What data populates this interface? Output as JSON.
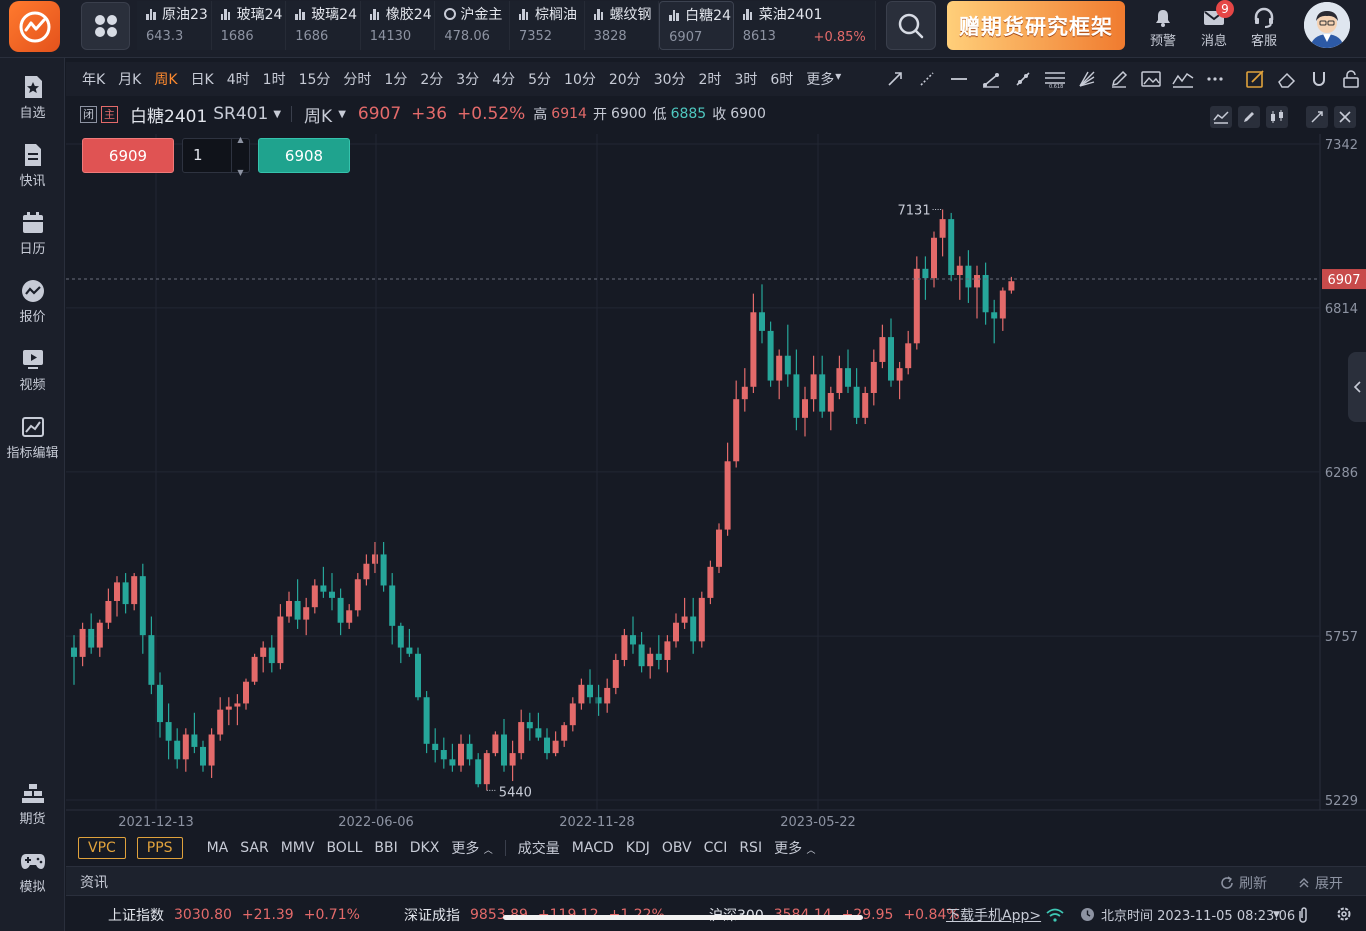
{
  "top": {
    "tickers": [
      {
        "name": "原油23",
        "price": "643.3",
        "change": ""
      },
      {
        "name": "玻璃24",
        "price": "1686",
        "change": ""
      },
      {
        "name": "玻璃24",
        "price": "1686",
        "change": ""
      },
      {
        "name": "橡胶24",
        "price": "14130",
        "change": ""
      },
      {
        "name": "沪金主",
        "price": "478.06",
        "change": ""
      },
      {
        "name": "棕榈油",
        "price": "7352",
        "change": ""
      },
      {
        "name": "螺纹钢",
        "price": "3828",
        "change": ""
      },
      {
        "name": "白糖24",
        "price": "6907",
        "change": ""
      },
      {
        "name": "菜油2401",
        "price": "8613",
        "change": "+0.85%"
      }
    ],
    "promo": "赠期货研究框架",
    "alert_label": "预警",
    "msg_label": "消息",
    "msg_badge": "9",
    "service_label": "客服"
  },
  "sidebar": {
    "items": [
      {
        "label": "自选",
        "icon": "star-doc-icon"
      },
      {
        "label": "快讯",
        "icon": "news-icon"
      },
      {
        "label": "日历",
        "icon": "calendar-icon"
      },
      {
        "label": "报价",
        "icon": "quote-icon"
      },
      {
        "label": "视频",
        "icon": "video-icon"
      },
      {
        "label": "指标编辑",
        "icon": "chart-edit-icon"
      },
      {
        "label": "期货",
        "icon": "futures-icon"
      },
      {
        "label": "模拟",
        "icon": "gamepad-icon"
      }
    ]
  },
  "toolbar": {
    "periods": [
      "年K",
      "月K",
      "周K",
      "日K",
      "4时",
      "1时",
      "15分",
      "分时",
      "1分",
      "2分",
      "3分",
      "4分",
      "5分",
      "10分",
      "20分",
      "30分",
      "2时",
      "3时",
      "6时",
      "更多"
    ],
    "selected": "周K"
  },
  "chart_header": {
    "tag1": "闭",
    "tag2": "主",
    "name": "白糖2401",
    "code": "SR401",
    "period": "周K",
    "last": "6907",
    "change": "+36",
    "pct": "+0.52%",
    "high_label": "高",
    "high": "6914",
    "open_label": "开",
    "open": "6900",
    "low_label": "低",
    "low": "6885",
    "close_label": "收",
    "close": "6900"
  },
  "trade": {
    "buy_price": "6909",
    "qty": "1",
    "sell_price": "6908"
  },
  "chart_data": {
    "type": "candlestick",
    "y_ticks": [
      "7342",
      "6814",
      "6286",
      "5757",
      "5229"
    ],
    "ylim": [
      5229,
      7342
    ],
    "x_ticks": [
      "2021-12-13",
      "2022-06-06",
      "2022-11-28",
      "2023-05-22"
    ],
    "current_price_label": "6907",
    "high_marker": "7131",
    "low_marker": "5440",
    "up_color": "#e36a6a",
    "down_color": "#26a69a",
    "ohlc": [
      [
        5720,
        5760,
        5600,
        5690
      ],
      [
        5690,
        5800,
        5660,
        5780
      ],
      [
        5780,
        5830,
        5700,
        5720
      ],
      [
        5720,
        5810,
        5690,
        5800
      ],
      [
        5800,
        5910,
        5780,
        5870
      ],
      [
        5870,
        5950,
        5820,
        5930
      ],
      [
        5930,
        5960,
        5830,
        5860
      ],
      [
        5860,
        5960,
        5840,
        5950
      ],
      [
        5950,
        5990,
        5700,
        5760
      ],
      [
        5760,
        5820,
        5570,
        5600
      ],
      [
        5600,
        5640,
        5430,
        5480
      ],
      [
        5480,
        5540,
        5360,
        5420
      ],
      [
        5420,
        5460,
        5330,
        5360
      ],
      [
        5360,
        5460,
        5320,
        5440
      ],
      [
        5440,
        5510,
        5380,
        5400
      ],
      [
        5400,
        5420,
        5320,
        5340
      ],
      [
        5340,
        5460,
        5300,
        5440
      ],
      [
        5440,
        5560,
        5420,
        5520
      ],
      [
        5520,
        5560,
        5470,
        5530
      ],
      [
        5530,
        5570,
        5470,
        5540
      ],
      [
        5540,
        5620,
        5520,
        5610
      ],
      [
        5610,
        5700,
        5600,
        5690
      ],
      [
        5690,
        5740,
        5640,
        5720
      ],
      [
        5720,
        5760,
        5640,
        5670
      ],
      [
        5670,
        5860,
        5650,
        5820
      ],
      [
        5820,
        5900,
        5800,
        5870
      ],
      [
        5870,
        5940,
        5780,
        5810
      ],
      [
        5810,
        5880,
        5760,
        5850
      ],
      [
        5850,
        5940,
        5830,
        5920
      ],
      [
        5920,
        5980,
        5880,
        5900
      ],
      [
        5900,
        5960,
        5840,
        5880
      ],
      [
        5880,
        5910,
        5760,
        5800
      ],
      [
        5800,
        5860,
        5780,
        5840
      ],
      [
        5840,
        5960,
        5820,
        5940
      ],
      [
        5940,
        6020,
        5920,
        5990
      ],
      [
        5990,
        6060,
        5960,
        6020
      ],
      [
        6020,
        6060,
        5900,
        5920
      ],
      [
        5920,
        5960,
        5730,
        5790
      ],
      [
        5790,
        5800,
        5670,
        5720
      ],
      [
        5720,
        5780,
        5690,
        5700
      ],
      [
        5700,
        5720,
        5550,
        5560
      ],
      [
        5560,
        5580,
        5380,
        5410
      ],
      [
        5410,
        5460,
        5350,
        5390
      ],
      [
        5390,
        5430,
        5330,
        5360
      ],
      [
        5360,
        5410,
        5320,
        5340
      ],
      [
        5340,
        5440,
        5320,
        5410
      ],
      [
        5410,
        5440,
        5340,
        5360
      ],
      [
        5360,
        5380,
        5270,
        5280
      ],
      [
        5280,
        5390,
        5260,
        5380
      ],
      [
        5380,
        5450,
        5370,
        5440
      ],
      [
        5440,
        5490,
        5320,
        5340
      ],
      [
        5340,
        5420,
        5290,
        5380
      ],
      [
        5380,
        5520,
        5360,
        5480
      ],
      [
        5480,
        5510,
        5420,
        5460
      ],
      [
        5460,
        5510,
        5420,
        5430
      ],
      [
        5430,
        5460,
        5360,
        5380
      ],
      [
        5380,
        5450,
        5370,
        5420
      ],
      [
        5420,
        5480,
        5400,
        5470
      ],
      [
        5470,
        5560,
        5450,
        5540
      ],
      [
        5540,
        5620,
        5520,
        5600
      ],
      [
        5600,
        5650,
        5540,
        5560
      ],
      [
        5560,
        5600,
        5500,
        5540
      ],
      [
        5540,
        5620,
        5510,
        5590
      ],
      [
        5590,
        5700,
        5570,
        5680
      ],
      [
        5680,
        5780,
        5660,
        5760
      ],
      [
        5760,
        5820,
        5700,
        5730
      ],
      [
        5730,
        5770,
        5640,
        5660
      ],
      [
        5660,
        5720,
        5620,
        5700
      ],
      [
        5700,
        5760,
        5650,
        5680
      ],
      [
        5680,
        5760,
        5640,
        5740
      ],
      [
        5740,
        5830,
        5720,
        5800
      ],
      [
        5800,
        5880,
        5780,
        5820
      ],
      [
        5820,
        5880,
        5700,
        5740
      ],
      [
        5740,
        5900,
        5720,
        5880
      ],
      [
        5880,
        6000,
        5860,
        5980
      ],
      [
        5980,
        6120,
        5960,
        6100
      ],
      [
        6100,
        6380,
        6080,
        6320
      ],
      [
        6320,
        6580,
        6300,
        6520
      ],
      [
        6520,
        6620,
        6480,
        6560
      ],
      [
        6560,
        6860,
        6540,
        6800
      ],
      [
        6800,
        6890,
        6700,
        6740
      ],
      [
        6740,
        6770,
        6560,
        6580
      ],
      [
        6580,
        6680,
        6520,
        6660
      ],
      [
        6660,
        6760,
        6560,
        6600
      ],
      [
        6600,
        6680,
        6420,
        6460
      ],
      [
        6460,
        6560,
        6400,
        6520
      ],
      [
        6520,
        6660,
        6480,
        6600
      ],
      [
        6600,
        6660,
        6460,
        6480
      ],
      [
        6480,
        6560,
        6420,
        6540
      ],
      [
        6540,
        6660,
        6520,
        6620
      ],
      [
        6620,
        6680,
        6540,
        6560
      ],
      [
        6560,
        6620,
        6440,
        6460
      ],
      [
        6460,
        6560,
        6440,
        6540
      ],
      [
        6540,
        6680,
        6500,
        6640
      ],
      [
        6640,
        6760,
        6620,
        6720
      ],
      [
        6720,
        6780,
        6560,
        6580
      ],
      [
        6580,
        6640,
        6520,
        6620
      ],
      [
        6620,
        6740,
        6600,
        6700
      ],
      [
        6700,
        6980,
        6680,
        6940
      ],
      [
        6940,
        6980,
        6840,
        6910
      ],
      [
        6910,
        7060,
        6880,
        7040
      ],
      [
        7040,
        7131,
        6980,
        7100
      ],
      [
        7100,
        7120,
        6900,
        6920
      ],
      [
        6920,
        6980,
        6840,
        6950
      ],
      [
        6950,
        7000,
        6830,
        6880
      ],
      [
        6880,
        6950,
        6780,
        6920
      ],
      [
        6920,
        6960,
        6760,
        6800
      ],
      [
        6800,
        6840,
        6700,
        6780
      ],
      [
        6780,
        6880,
        6740,
        6870
      ],
      [
        6870,
        6914,
        6860,
        6900
      ]
    ]
  },
  "indicators": {
    "main_active": [
      "VPC",
      "PPS"
    ],
    "main": [
      "MA",
      "SAR",
      "MMV",
      "BOLL",
      "BBI",
      "DKX",
      "更多"
    ],
    "sub": [
      "成交量",
      "MACD",
      "KDJ",
      "OBV",
      "CCI",
      "RSI",
      "更多"
    ]
  },
  "news": {
    "title": "资讯",
    "refresh": "刷新",
    "expand": "展开"
  },
  "status": {
    "indices": [
      {
        "name": "上证指数",
        "value": "3030.80",
        "change": "+21.39",
        "pct": "+0.71%"
      },
      {
        "name": "深证成指",
        "value": "9853.89",
        "change": "+119.12",
        "pct": "+1.22%"
      },
      {
        "name": "沪深300",
        "value": "3584.14",
        "change": "+29.95",
        "pct": "+0.84%"
      }
    ],
    "app_link": "下载手机App>",
    "time": "北京时间 2023-11-05 08:23:06"
  }
}
